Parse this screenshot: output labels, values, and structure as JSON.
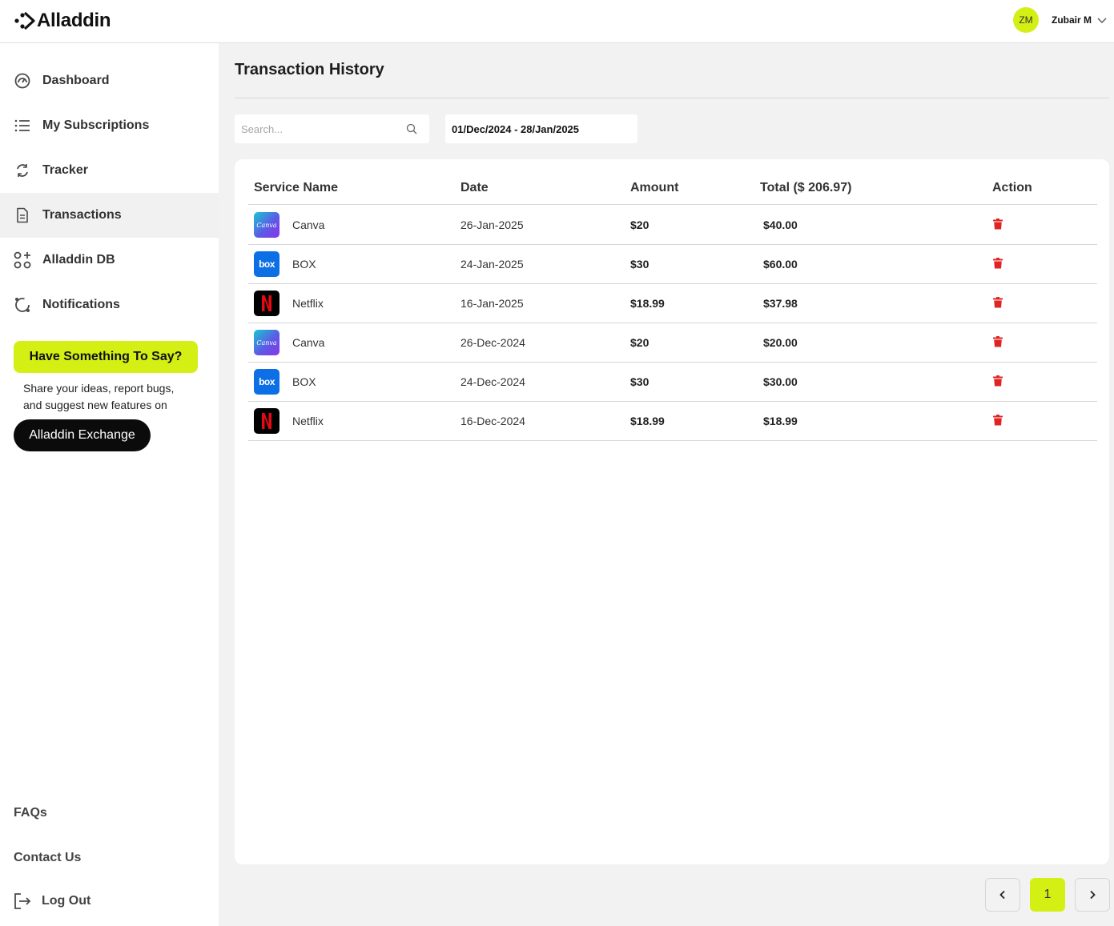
{
  "brand": {
    "name": "Alladdin",
    "accent": "#d4ef14"
  },
  "user": {
    "initials": "ZM",
    "name": "Zubair M"
  },
  "sidebar": {
    "items": [
      {
        "label": "Dashboard",
        "icon": "gauge-icon"
      },
      {
        "label": "My Subscriptions",
        "icon": "list-icon"
      },
      {
        "label": "Tracker",
        "icon": "refresh-icon"
      },
      {
        "label": "Transactions",
        "icon": "document-icon",
        "active": true
      },
      {
        "label": "Alladdin DB",
        "icon": "grid-plus-icon"
      },
      {
        "label": "Notifications",
        "icon": "bell-icon"
      }
    ],
    "feedback": {
      "button": "Have Something To Say?",
      "text": "Share your ideas, report bugs, and suggest new features on",
      "exchange": "Alladdin Exchange"
    },
    "footer": {
      "faqs": "FAQs",
      "contact": "Contact Us",
      "logout": "Log Out"
    }
  },
  "main": {
    "title": "Transaction History",
    "search_placeholder": "Search...",
    "date_range": "01/Dec/2024 - 28/Jan/2025",
    "table": {
      "headers": {
        "service": "Service Name",
        "date": "Date",
        "amount": "Amount",
        "total": "Total ($ 206.97)",
        "action": "Action"
      },
      "rows": [
        {
          "service": "Canva",
          "logo": "canva",
          "date": "26-Jan-2025",
          "amount": "$20",
          "total": "$40.00"
        },
        {
          "service": "BOX",
          "logo": "box",
          "date": "24-Jan-2025",
          "amount": "$30",
          "total": "$60.00"
        },
        {
          "service": "Netflix",
          "logo": "netflix",
          "date": "16-Jan-2025",
          "amount": "$18.99",
          "total": "$37.98"
        },
        {
          "service": "Canva",
          "logo": "canva",
          "date": "26-Dec-2024",
          "amount": "$20",
          "total": "$20.00"
        },
        {
          "service": "BOX",
          "logo": "box",
          "date": "24-Dec-2024",
          "amount": "$30",
          "total": "$30.00"
        },
        {
          "service": "Netflix",
          "logo": "netflix",
          "date": "16-Dec-2024",
          "amount": "$18.99",
          "total": "$18.99"
        }
      ]
    },
    "logo_text": {
      "canva": "Canva",
      "box": "box"
    },
    "delete_color": "#e02424",
    "pagination": {
      "current": "1"
    }
  }
}
